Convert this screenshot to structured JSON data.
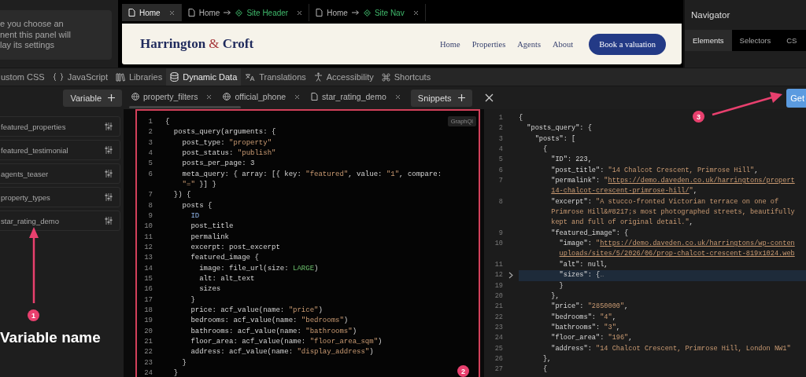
{
  "hint_lines": [
    "e you choose an",
    "nent this panel will",
    "lay its settings"
  ],
  "canvas_tabs": [
    {
      "page": "Home",
      "selected": true
    },
    {
      "page": "Home",
      "component": "Site Header",
      "selected": false
    },
    {
      "page": "Home",
      "component": "Site Nav",
      "selected": false
    }
  ],
  "site": {
    "logo": [
      {
        "text": "Harrington",
        "accent": false
      },
      {
        "text": "&",
        "accent": true
      },
      {
        "text": "Croft",
        "accent": false
      }
    ],
    "nav": [
      "Home",
      "Properties",
      "Agents",
      "About"
    ],
    "cta": "Book a valuation"
  },
  "navigator": {
    "title": "Navigator",
    "tabs": [
      {
        "label": "Elements",
        "selected": true
      },
      {
        "label": "Selectors",
        "selected": false
      },
      {
        "label": "CS",
        "selected": false
      }
    ]
  },
  "toolbar": [
    {
      "label": "ustom CSS",
      "kind": "text",
      "selected": false
    },
    {
      "label": "JavaScript",
      "kind": "braces",
      "selected": false
    },
    {
      "label": "Libraries",
      "kind": "books",
      "selected": false
    },
    {
      "label": "Dynamic Data",
      "kind": "database",
      "selected": true
    },
    {
      "label": "Translations",
      "kind": "translate",
      "selected": false
    },
    {
      "label": "Accessibility",
      "kind": "person",
      "selected": false
    },
    {
      "label": "Shortcuts",
      "kind": "command",
      "selected": false
    }
  ],
  "variable_button": "Variable",
  "variable_tabs": [
    {
      "label": "property_filters",
      "kind": "globe",
      "selected": false
    },
    {
      "label": "official_phone",
      "kind": "globe",
      "selected": false
    },
    {
      "label": "star_rating_demo",
      "kind": "page",
      "selected": false
    }
  ],
  "snippets_button": "Snippets",
  "get_button": "Get",
  "variables": [
    "featured_properties",
    "featured_testimonial",
    "agents_teaser",
    "property_types",
    "star_rating_demo"
  ],
  "editor_badge": "GraphQl",
  "query_lines": [
    {
      "n": "1",
      "text": "{"
    },
    {
      "n": "2",
      "text": "  posts_query(arguments: {"
    },
    {
      "n": "3",
      "tokens": [
        {
          "kind": "plain",
          "text": "    post_type: "
        },
        {
          "kind": "string",
          "text": "\"property\""
        }
      ]
    },
    {
      "n": "4",
      "tokens": [
        {
          "kind": "plain",
          "text": "    post_status: "
        },
        {
          "kind": "string",
          "text": "\"publish\""
        }
      ]
    },
    {
      "n": "5",
      "text": "    posts_per_page: 3"
    },
    {
      "n": "6",
      "tokens": [
        {
          "kind": "plain",
          "text": "    meta_query: { array: [{ key: "
        },
        {
          "kind": "string",
          "text": "\"featured\""
        },
        {
          "kind": "plain",
          "text": ", value: "
        },
        {
          "kind": "string",
          "text": "\"1\""
        },
        {
          "kind": "plain",
          "text": ", compare:"
        }
      ]
    },
    {
      "tokens": [
        {
          "kind": "string",
          "text": "    \"=\""
        },
        {
          "kind": "plain",
          "text": " }] }"
        }
      ]
    },
    {
      "n": "7",
      "text": "  }) {"
    },
    {
      "n": "8",
      "text": "    posts {"
    },
    {
      "n": "9",
      "tokens": [
        {
          "kind": "field",
          "text": "      ID"
        }
      ]
    },
    {
      "n": "10",
      "text": "      post_title"
    },
    {
      "n": "11",
      "text": "      permalink"
    },
    {
      "n": "12",
      "text": "      excerpt: post_excerpt"
    },
    {
      "n": "13",
      "text": "      featured_image {"
    },
    {
      "n": "14",
      "tokens": [
        {
          "kind": "plain",
          "text": "        image: file_url(size: "
        },
        {
          "kind": "enum",
          "text": "LARGE"
        },
        {
          "kind": "plain",
          "text": ")"
        }
      ]
    },
    {
      "n": "15",
      "text": "        alt: alt_text"
    },
    {
      "n": "16",
      "text": "        sizes"
    },
    {
      "n": "17",
      "text": "      }"
    },
    {
      "n": "18",
      "tokens": [
        {
          "kind": "plain",
          "text": "      price: acf_value(name: "
        },
        {
          "kind": "string",
          "text": "\"price\""
        },
        {
          "kind": "plain",
          "text": ")"
        }
      ]
    },
    {
      "n": "19",
      "tokens": [
        {
          "kind": "plain",
          "text": "      bedrooms: acf_value(name: "
        },
        {
          "kind": "string",
          "text": "\"bedrooms\""
        },
        {
          "kind": "plain",
          "text": ")"
        }
      ]
    },
    {
      "n": "20",
      "tokens": [
        {
          "kind": "plain",
          "text": "      bathrooms: acf_value(name: "
        },
        {
          "kind": "string",
          "text": "\"bathrooms\""
        },
        {
          "kind": "plain",
          "text": ")"
        }
      ]
    },
    {
      "n": "21",
      "tokens": [
        {
          "kind": "plain",
          "text": "      floor_area: acf_value(name: "
        },
        {
          "kind": "string",
          "text": "\"floor_area_sqm\""
        },
        {
          "kind": "plain",
          "text": ")"
        }
      ]
    },
    {
      "n": "22",
      "tokens": [
        {
          "kind": "plain",
          "text": "      address: acf_value(name: "
        },
        {
          "kind": "string",
          "text": "\"display_address\""
        },
        {
          "kind": "plain",
          "text": ")"
        }
      ]
    },
    {
      "n": "23",
      "text": "    }"
    },
    {
      "n": "24",
      "text": "  }"
    }
  ],
  "result_lines": [
    {
      "n": "1",
      "active": false,
      "folded": false,
      "text": "{"
    },
    {
      "n": "2",
      "active": false,
      "folded": false,
      "text": "  \"posts_query\": {"
    },
    {
      "n": "3",
      "active": false,
      "folded": false,
      "text": "    \"posts\": ["
    },
    {
      "n": "4",
      "active": false,
      "folded": false,
      "text": "      {"
    },
    {
      "n": "5",
      "active": false,
      "folded": false,
      "text": "        \"ID\": 223,"
    },
    {
      "n": "6",
      "active": false,
      "folded": false,
      "tokens": [
        {
          "kind": "plain",
          "text": "        \"post_title\": "
        },
        {
          "kind": "string",
          "text": "\"14 Chalcot Crescent, Primrose Hill\""
        },
        {
          "kind": "plain",
          "text": ","
        }
      ]
    },
    {
      "n": "7",
      "active": false,
      "folded": false,
      "tokens": [
        {
          "kind": "plain",
          "text": "        \"permalink\": "
        },
        {
          "kind": "string",
          "text": "\""
        },
        {
          "kind": "link",
          "text": "https://demo.daveden.co.uk/harringtons/propert"
        }
      ]
    },
    {
      "active": false,
      "folded": false,
      "tokens": [
        {
          "kind": "link",
          "text": "        14-chalcot-crescent-primrose-hill/"
        },
        {
          "kind": "string",
          "text": "\""
        },
        {
          "kind": "plain",
          "text": ","
        }
      ]
    },
    {
      "n": "8",
      "active": false,
      "folded": false,
      "tokens": [
        {
          "kind": "plain",
          "text": "        \"excerpt\": "
        },
        {
          "kind": "string",
          "text": "\"A stucco-fronted Victorian terrace on one of"
        }
      ]
    },
    {
      "active": false,
      "folded": false,
      "tokens": [
        {
          "kind": "string",
          "text": "        Primrose Hill&#8217;s most photographed streets, beautifully"
        }
      ]
    },
    {
      "active": false,
      "folded": false,
      "tokens": [
        {
          "kind": "string",
          "text": "        kept and full of original detail.\""
        },
        {
          "kind": "plain",
          "text": ","
        }
      ]
    },
    {
      "n": "9",
      "active": false,
      "folded": false,
      "text": "        \"featured_image\": {"
    },
    {
      "n": "10",
      "active": false,
      "folded": false,
      "tokens": [
        {
          "kind": "plain",
          "text": "          \"image\": "
        },
        {
          "kind": "string",
          "text": "\""
        },
        {
          "kind": "link",
          "text": "https://demo.daveden.co.uk/harringtons/wp-conten"
        }
      ]
    },
    {
      "active": false,
      "folded": false,
      "tokens": [
        {
          "kind": "link",
          "text": "          uploads/sites/5/2026/06/prop-chalcot-crescent-819x1024.web"
        }
      ]
    },
    {
      "n": "11",
      "active": false,
      "folded": false,
      "text": "          \"alt\": null,"
    },
    {
      "n": "12",
      "active": true,
      "folded": true,
      "tokens": [
        {
          "kind": "plain",
          "text": "          \"sizes\": {"
        },
        {
          "kind": "dim",
          "text": "…"
        }
      ]
    },
    {
      "n": "19",
      "active": false,
      "folded": false,
      "text": "          }"
    },
    {
      "n": "20",
      "active": false,
      "folded": false,
      "text": "        },"
    },
    {
      "n": "21",
      "active": false,
      "folded": false,
      "tokens": [
        {
          "kind": "plain",
          "text": "        \"price\": "
        },
        {
          "kind": "string",
          "text": "\"2850000\""
        },
        {
          "kind": "plain",
          "text": ","
        }
      ]
    },
    {
      "n": "22",
      "active": false,
      "folded": false,
      "tokens": [
        {
          "kind": "plain",
          "text": "        \"bedrooms\": "
        },
        {
          "kind": "string",
          "text": "\"4\""
        },
        {
          "kind": "plain",
          "text": ","
        }
      ]
    },
    {
      "n": "23",
      "active": false,
      "folded": false,
      "tokens": [
        {
          "kind": "plain",
          "text": "        \"bathrooms\": "
        },
        {
          "kind": "string",
          "text": "\"3\""
        },
        {
          "kind": "plain",
          "text": ","
        }
      ]
    },
    {
      "n": "24",
      "active": false,
      "folded": false,
      "tokens": [
        {
          "kind": "plain",
          "text": "        \"floor_area\": "
        },
        {
          "kind": "string",
          "text": "\"196\""
        },
        {
          "kind": "plain",
          "text": ","
        }
      ]
    },
    {
      "n": "25",
      "active": false,
      "folded": false,
      "tokens": [
        {
          "kind": "plain",
          "text": "        \"address\": "
        },
        {
          "kind": "string",
          "text": "\"14 Chalcot Crescent, Primrose Hill, London NW1\""
        }
      ]
    },
    {
      "n": "26",
      "active": false,
      "folded": false,
      "text": "      },"
    },
    {
      "n": "27",
      "active": false,
      "folded": false,
      "text": "      {"
    }
  ],
  "annotations": [
    {
      "number": "1"
    },
    {
      "number": "2"
    },
    {
      "number": "3"
    }
  ],
  "caption": "Variable name"
}
